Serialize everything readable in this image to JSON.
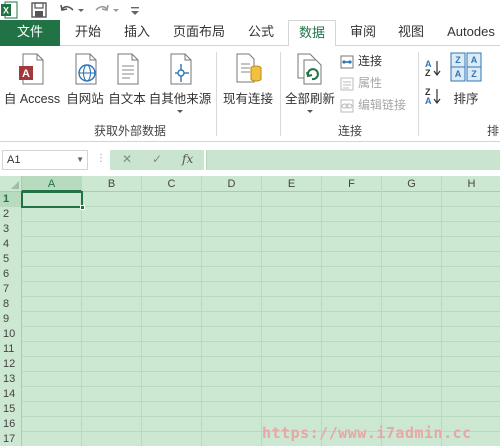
{
  "tabs": [
    {
      "label": "文件"
    },
    {
      "label": "开始"
    },
    {
      "label": "插入"
    },
    {
      "label": "页面布局"
    },
    {
      "label": "公式"
    },
    {
      "label": "数据"
    },
    {
      "label": "审阅"
    },
    {
      "label": "视图"
    },
    {
      "label": "Autodes"
    }
  ],
  "active_tab": "数据",
  "ribbon": {
    "get_external": {
      "access": "自 Access",
      "web": "自网站",
      "text": "自文本",
      "other": "自其他来源",
      "existing": "现有连接",
      "group_label": "获取外部数据"
    },
    "connections": {
      "refresh_all": "全部刷新",
      "connections": "连接",
      "properties": "属性",
      "edit_links": "编辑链接",
      "group_label": "连接"
    },
    "sort": {
      "sort": "排序",
      "group_label_partial": "排"
    }
  },
  "formula_bar": {
    "name_box": "A1",
    "cancel_glyph": "✕",
    "enter_glyph": "✓",
    "fx_glyph": "fx",
    "value": ""
  },
  "grid": {
    "columns": [
      "A",
      "B",
      "C",
      "D",
      "E",
      "F",
      "G",
      "H"
    ],
    "rows": [
      "1",
      "2",
      "3",
      "4",
      "5",
      "6",
      "7",
      "8",
      "9",
      "10",
      "11",
      "12",
      "13",
      "14",
      "15",
      "16",
      "17"
    ],
    "selected_cell": "A1"
  },
  "watermark": "https://www.i7admin.cc",
  "colors": {
    "brand": "#217346",
    "grid_bg": "#cde8d2"
  }
}
